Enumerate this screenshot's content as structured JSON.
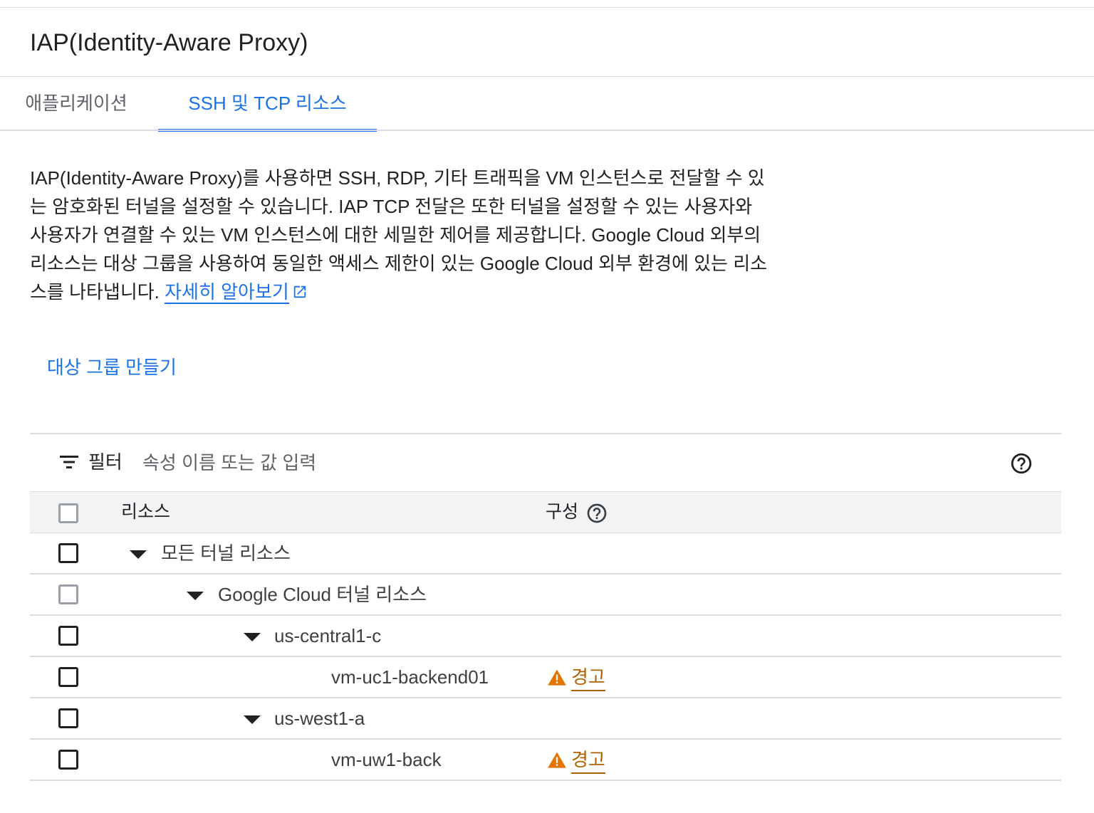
{
  "header": {
    "title": "IAP(Identity-Aware Proxy)"
  },
  "tabs": [
    {
      "label": "애플리케이션",
      "active": false
    },
    {
      "label": "SSH 및 TCP 리소스",
      "active": true
    }
  ],
  "description": {
    "text": "IAP(Identity-Aware Proxy)를 사용하면 SSH, RDP, 기타 트래픽을 VM 인스턴스로 전달할 수 있는 암호화된 터널을 설정할 수 있습니다. IAP TCP 전달은 또한 터널을 설정할 수 있는 사용자와 사용자가 연결할 수 있는 VM 인스턴스에 대한 세밀한 제어를 제공합니다. Google Cloud 외부의 리소스는 대상 그룹을 사용하여 동일한 액세스 제한이 있는 Google Cloud 외부 환경에 있는 리소스를 나타냅니다.",
    "learn_more": "자세히 알아보기"
  },
  "actions": {
    "create_target_group": "대상 그룹 만들기"
  },
  "filter": {
    "label": "필터",
    "placeholder": "속성 이름 또는 값 입력"
  },
  "table": {
    "columns": {
      "resource": "리소스",
      "config": "구성"
    },
    "rows": [
      {
        "label": "모든 터널 리소스",
        "expandable": true,
        "checkbox_enabled": true,
        "config": ""
      },
      {
        "label": "Google Cloud 터널 리소스",
        "expandable": true,
        "checkbox_enabled": false,
        "config": ""
      },
      {
        "label": "us-central1-c",
        "expandable": true,
        "checkbox_enabled": true,
        "config": ""
      },
      {
        "label": "vm-uc1-backend01",
        "expandable": false,
        "checkbox_enabled": true,
        "config": "경고"
      },
      {
        "label": "us-west1-a",
        "expandable": true,
        "checkbox_enabled": true,
        "config": ""
      },
      {
        "label": "vm-uw1-back",
        "expandable": false,
        "checkbox_enabled": true,
        "config": "경고"
      }
    ]
  },
  "colors": {
    "accent": "#1a73e8",
    "warning": "#e37400",
    "warning_text": "#b06000"
  }
}
